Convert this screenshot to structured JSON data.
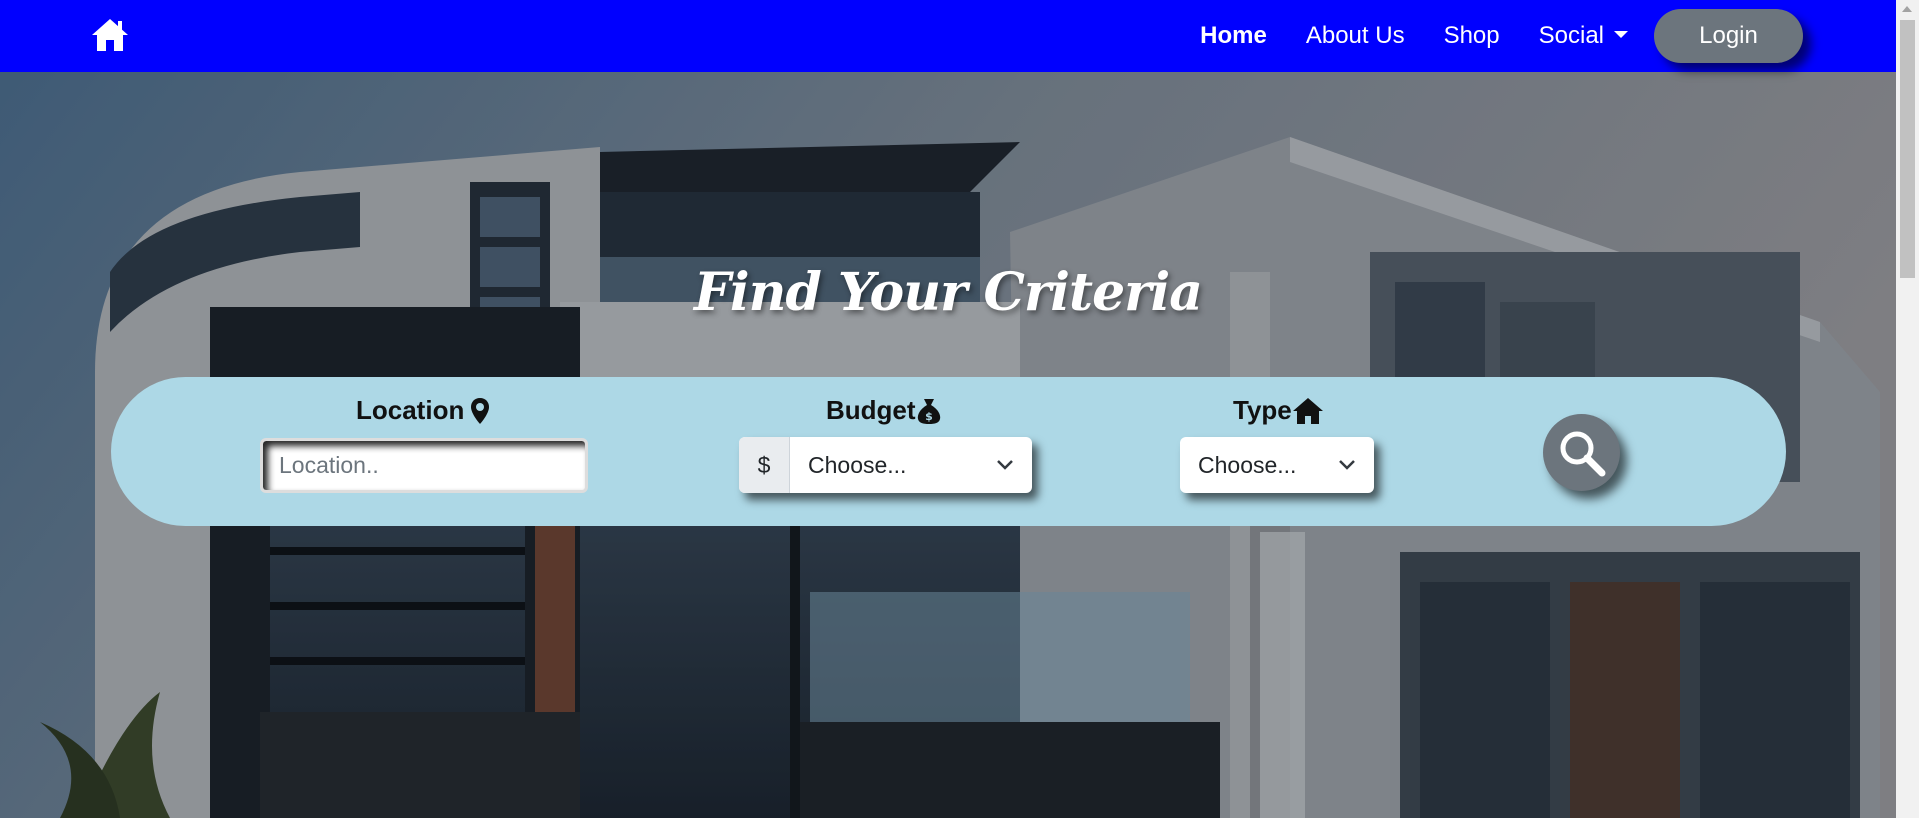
{
  "nav": {
    "brand_icon": "home-icon",
    "links": [
      {
        "label": "Home",
        "active": true
      },
      {
        "label": "About Us",
        "active": false
      },
      {
        "label": "Shop",
        "active": false
      }
    ],
    "social_label": "Social",
    "login_label": "Login",
    "bar_color": "#0000ff",
    "login_color": "#6c757d"
  },
  "hero": {
    "title": "Find Your Criteria"
  },
  "search": {
    "panel_color": "#add8e6",
    "location": {
      "label": "Location",
      "icon": "map-marker-icon",
      "placeholder": "Location..",
      "value": ""
    },
    "budget": {
      "label": "Budget",
      "icon": "money-bag-icon",
      "prefix": "$",
      "selected": "Choose..."
    },
    "type": {
      "label": "Type",
      "icon": "home-icon",
      "selected": "Choose..."
    },
    "button_icon": "search-icon"
  }
}
